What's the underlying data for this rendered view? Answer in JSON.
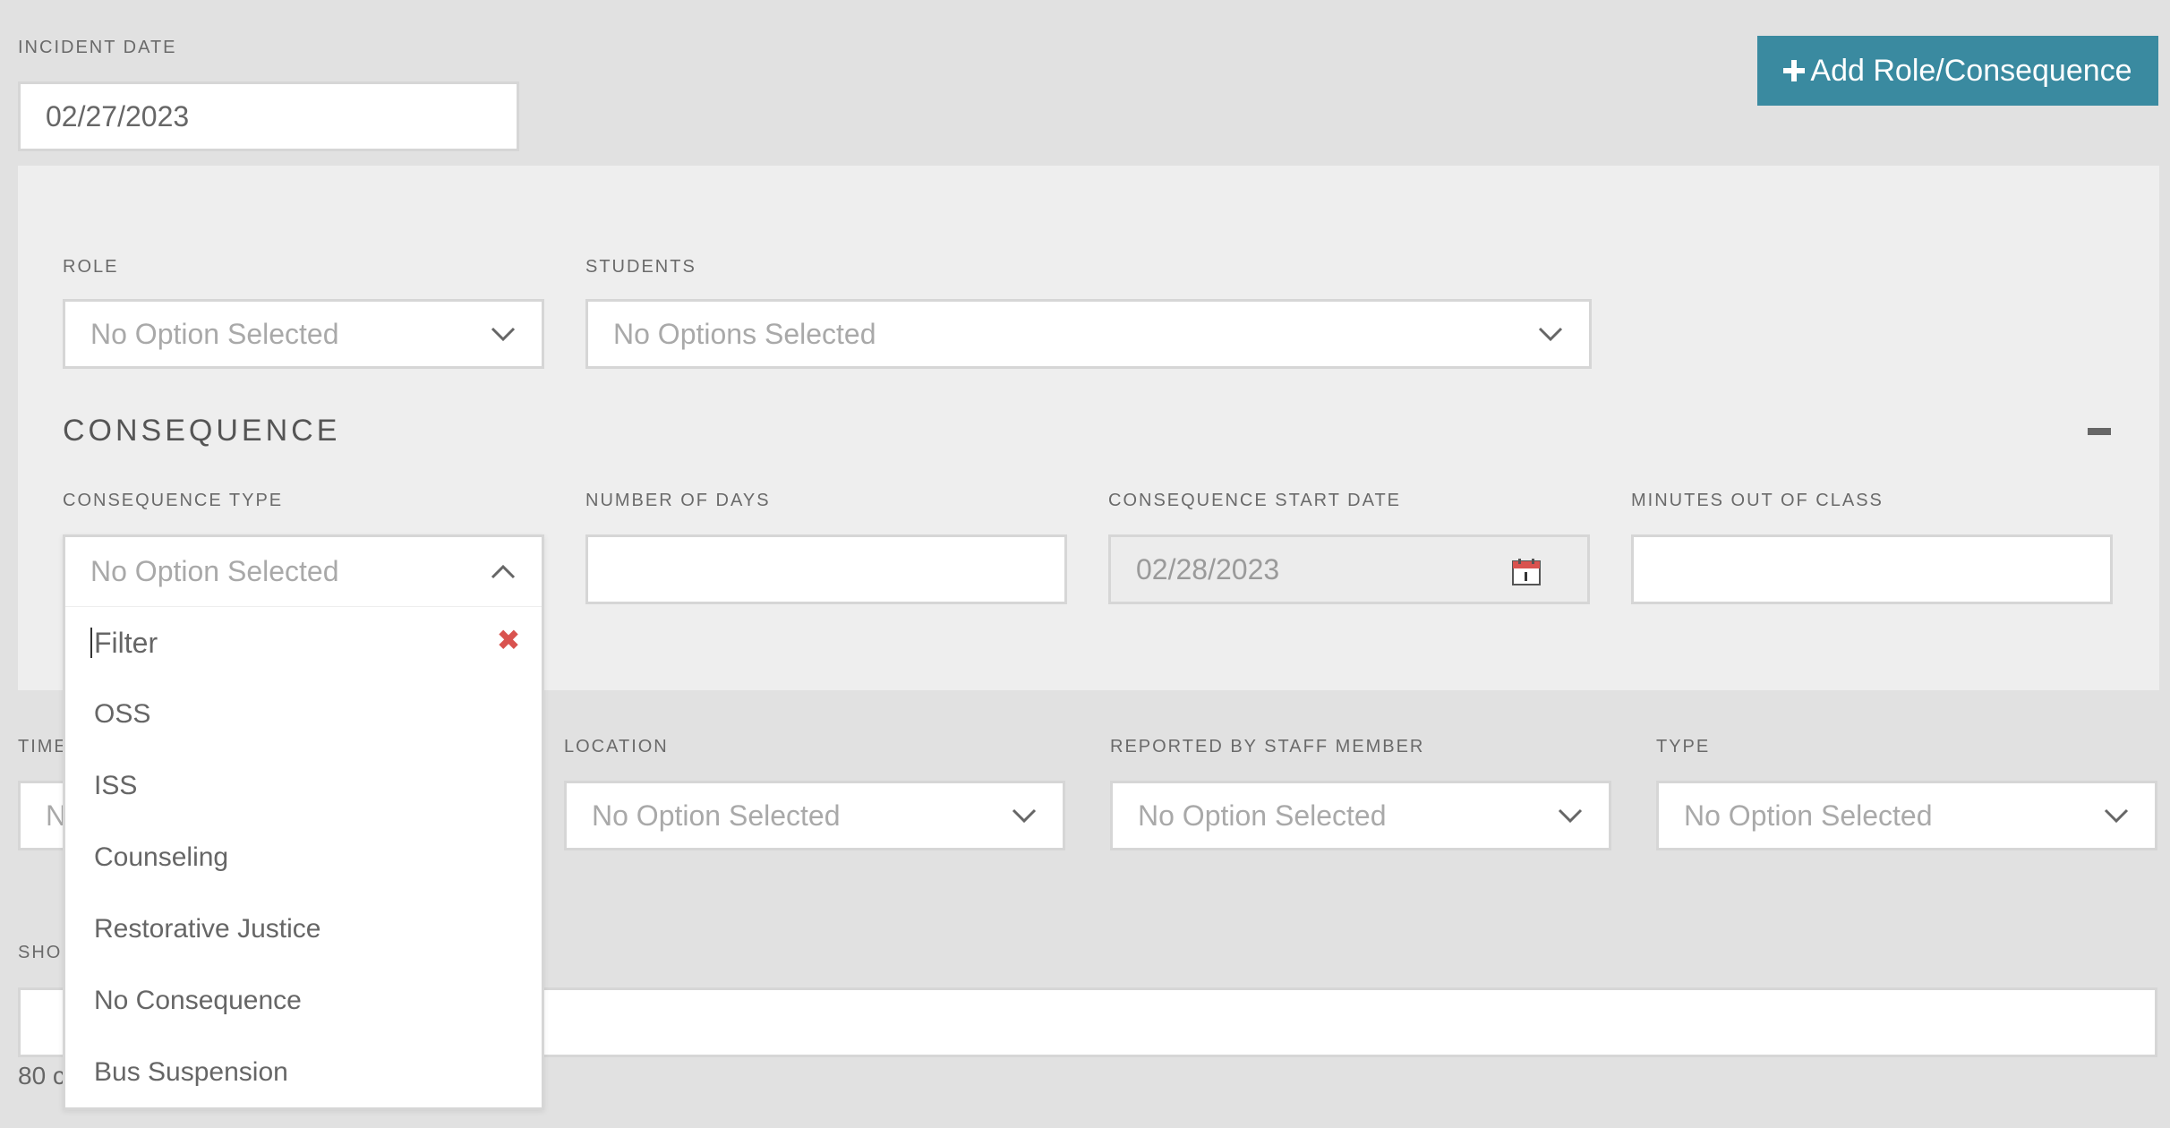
{
  "incident_date": {
    "label": "INCIDENT DATE",
    "value": "02/27/2023"
  },
  "add_button": {
    "label": "Add Role/Consequence",
    "icon": "plus-icon"
  },
  "role": {
    "label": "ROLE",
    "value": "No Option Selected"
  },
  "students": {
    "label": "STUDENTS",
    "value": "No Options Selected"
  },
  "consequence": {
    "title": "CONSEQUENCE",
    "type": {
      "label": "CONSEQUENCE TYPE",
      "value": "No Option Selected"
    },
    "days": {
      "label": "NUMBER OF DAYS",
      "value": ""
    },
    "start_date": {
      "label": "CONSEQUENCE START DATE",
      "value": "02/28/2023"
    },
    "minutes": {
      "label": "MINUTES OUT OF CLASS",
      "value": ""
    }
  },
  "dropdown": {
    "filter_placeholder": "Filter",
    "options": [
      "OSS",
      "ISS",
      "Counseling",
      "Restorative Justice",
      "No Consequence",
      "Bus Suspension"
    ]
  },
  "time": {
    "label": "TIME",
    "value": "N"
  },
  "location": {
    "label": "LOCATION",
    "value": "No Option Selected"
  },
  "reported_by": {
    "label": "REPORTED BY STAFF MEMBER",
    "value": "No Option Selected"
  },
  "type": {
    "label": "TYPE",
    "value": "No Option Selected"
  },
  "short_description": {
    "label": "SHO",
    "value": "",
    "counter": "80 c"
  },
  "colors": {
    "accent": "#3a8aa0",
    "clear": "#d9534f",
    "panel": "#eeeeee",
    "background": "#e1e1e1"
  }
}
